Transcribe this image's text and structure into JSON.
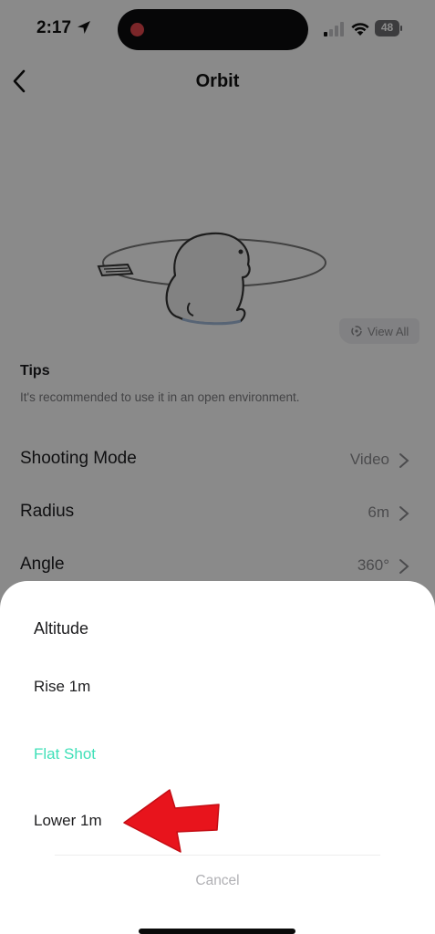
{
  "status_bar": {
    "time": "2:17",
    "battery": "48",
    "icons": [
      "location-arrow-icon",
      "cellular-signal-icon",
      "wifi-icon",
      "battery-icon"
    ],
    "recording_dot_color": "#e0464b"
  },
  "header": {
    "title": "Orbit",
    "back_icon": "chevron-left-icon"
  },
  "illustration": {
    "view_all_label": "View All",
    "view_all_icon": "orbit-icon"
  },
  "tips": {
    "title": "Tips",
    "text": "It's recommended to use it in an open environment."
  },
  "settings": [
    {
      "label": "Shooting Mode",
      "value": "Video"
    },
    {
      "label": "Radius",
      "value": "6m"
    },
    {
      "label": "Angle",
      "value": "360°"
    }
  ],
  "sheet": {
    "title": "Altitude",
    "options": [
      {
        "label": "Rise 1m",
        "selected": false
      },
      {
        "label": "Flat Shot",
        "selected": true
      },
      {
        "label": "Lower 1m",
        "selected": false
      }
    ],
    "cancel_label": "Cancel",
    "selected_color": "#3fe0b8",
    "annotation": "red-arrow-icon"
  }
}
